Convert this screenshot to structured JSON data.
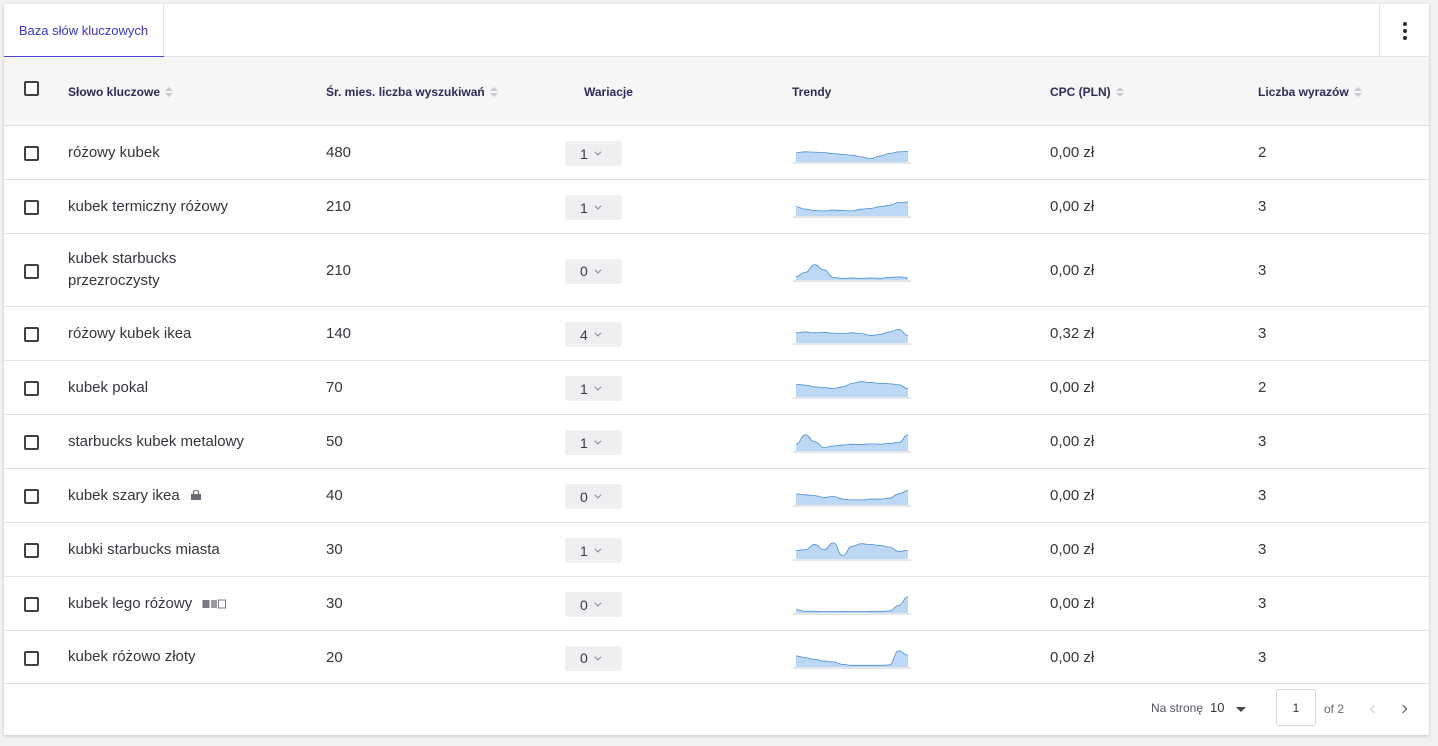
{
  "tabs": [
    {
      "label": "Baza słów kluczowych",
      "active": true
    }
  ],
  "columns": {
    "keyword": "Słowo kluczowe",
    "volume": "Śr. mies. liczba wyszukiwań",
    "variations": "Wariacje",
    "trends": "Trendy",
    "cpc": "CPC (PLN)",
    "words": "Liczba wyrazów"
  },
  "rows": [
    {
      "keyword": "różowy kubek",
      "volume": "480",
      "variations": "1",
      "cpc": "0,00 zł",
      "words": "2",
      "icon": null,
      "trend": [
        0.55,
        0.6,
        0.58,
        0.55,
        0.5,
        0.45,
        0.4,
        0.3,
        0.2,
        0.35,
        0.5,
        0.6,
        0.62
      ]
    },
    {
      "keyword": "kubek termiczny różowy",
      "volume": "210",
      "variations": "1",
      "cpc": "0,00 zł",
      "words": "3",
      "icon": null,
      "trend": [
        0.55,
        0.4,
        0.32,
        0.3,
        0.35,
        0.32,
        0.3,
        0.4,
        0.45,
        0.55,
        0.62,
        0.8,
        0.82
      ]
    },
    {
      "keyword": "kubek starbucks przezroczysty",
      "volume": "210",
      "variations": "0",
      "cpc": "0,00 zł",
      "words": "3",
      "icon": null,
      "trend": [
        0.2,
        0.45,
        0.9,
        0.6,
        0.15,
        0.1,
        0.12,
        0.1,
        0.12,
        0.1,
        0.15,
        0.18,
        0.12
      ]
    },
    {
      "keyword": "różowy kubek ikea",
      "volume": "140",
      "variations": "4",
      "cpc": "0,32 zł",
      "words": "3",
      "icon": null,
      "trend": [
        0.6,
        0.65,
        0.6,
        0.62,
        0.58,
        0.55,
        0.6,
        0.55,
        0.45,
        0.5,
        0.65,
        0.8,
        0.45
      ]
    },
    {
      "keyword": "kubek pokal",
      "volume": "70",
      "variations": "1",
      "cpc": "0,00 zł",
      "words": "2",
      "icon": null,
      "trend": [
        0.75,
        0.7,
        0.6,
        0.55,
        0.5,
        0.6,
        0.8,
        0.9,
        0.85,
        0.8,
        0.78,
        0.72,
        0.5
      ]
    },
    {
      "keyword": "starbucks kubek metalowy",
      "volume": "50",
      "variations": "1",
      "cpc": "0,00 zł",
      "words": "3",
      "icon": null,
      "trend": [
        0.4,
        0.95,
        0.55,
        0.2,
        0.3,
        0.35,
        0.4,
        0.38,
        0.42,
        0.4,
        0.45,
        0.5,
        0.95
      ]
    },
    {
      "keyword": "kubek szary ikea",
      "volume": "40",
      "variations": "0",
      "cpc": "0,00 zł",
      "words": "3",
      "icon": "bag",
      "trend": [
        0.65,
        0.6,
        0.55,
        0.45,
        0.5,
        0.35,
        0.3,
        0.3,
        0.35,
        0.35,
        0.4,
        0.65,
        0.85
      ]
    },
    {
      "keyword": "kubki starbucks miasta",
      "volume": "30",
      "variations": "1",
      "cpc": "0,00 zł",
      "words": "3",
      "icon": null,
      "trend": [
        0.5,
        0.55,
        0.85,
        0.55,
        0.95,
        0.2,
        0.75,
        0.9,
        0.85,
        0.8,
        0.7,
        0.45,
        0.5
      ]
    },
    {
      "keyword": "kubek lego różowy",
      "volume": "30",
      "variations": "0",
      "cpc": "0,00 zł",
      "words": "3",
      "icon": "images",
      "trend": [
        0.2,
        0.1,
        0.1,
        0.08,
        0.08,
        0.1,
        0.08,
        0.08,
        0.1,
        0.1,
        0.12,
        0.45,
        0.95
      ]
    },
    {
      "keyword": "kubek różowo złoty",
      "volume": "20",
      "variations": "0",
      "cpc": "0,00 zł",
      "words": "3",
      "icon": null,
      "trend": [
        0.65,
        0.55,
        0.45,
        0.35,
        0.3,
        0.15,
        0.1,
        0.1,
        0.1,
        0.1,
        0.12,
        0.95,
        0.7
      ]
    }
  ],
  "pagination": {
    "per_page_label": "Na stronę",
    "per_page_value": "10",
    "current_page": "1",
    "of_label": "of 2"
  },
  "colors": {
    "accent": "#4b46d8",
    "trend_fill": "#bcd8f5",
    "trend_stroke": "#4a8fd8"
  }
}
